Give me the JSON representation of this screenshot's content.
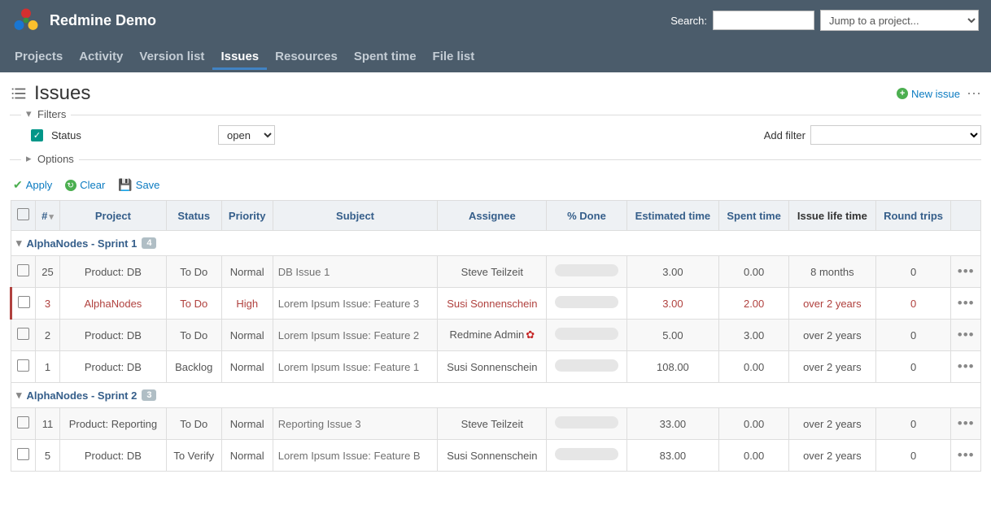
{
  "header": {
    "app_title": "Redmine Demo",
    "search_label": "Search:",
    "jump_placeholder": "Jump to a project..."
  },
  "nav": {
    "items": [
      "Projects",
      "Activity",
      "Version list",
      "Issues",
      "Resources",
      "Spent time",
      "File list"
    ],
    "active_index": 3
  },
  "page": {
    "title": "Issues",
    "new_issue_label": "New issue"
  },
  "filters": {
    "legend": "Filters",
    "status_label": "Status",
    "status_value": "open",
    "add_filter_label": "Add filter"
  },
  "options": {
    "legend": "Options"
  },
  "actions": {
    "apply": "Apply",
    "clear": "Clear",
    "save": "Save"
  },
  "table": {
    "columns": [
      "",
      "#",
      "Project",
      "Status",
      "Priority",
      "Subject",
      "Assignee",
      "% Done",
      "Estimated time",
      "Spent time",
      "Issue life time",
      "Round trips",
      ""
    ],
    "groups": [
      {
        "title": "AlphaNodes - Sprint 1",
        "count": "4",
        "rows": [
          {
            "id": "25",
            "project": "Product: DB",
            "status": "To Do",
            "priority": "Normal",
            "subject": "DB Issue 1",
            "assignee": "Steve Teilzeit",
            "est": "3.00",
            "spent": "0.00",
            "life": "8 months",
            "trips": "0",
            "red": false,
            "odd": true
          },
          {
            "id": "3",
            "project": "AlphaNodes",
            "status": "To Do",
            "priority": "High",
            "subject": "Lorem Ipsum Issue: Feature 3",
            "assignee": "Susi Sonnenschein",
            "est": "3.00",
            "spent": "2.00",
            "life": "over 2 years",
            "trips": "0",
            "red": true,
            "odd": false
          },
          {
            "id": "2",
            "project": "Product: DB",
            "status": "To Do",
            "priority": "Normal",
            "subject": "Lorem Ipsum Issue: Feature 2",
            "assignee": "Redmine Admin",
            "est": "5.00",
            "spent": "3.00",
            "life": "over 2 years",
            "trips": "0",
            "red": false,
            "odd": true,
            "admin": true
          },
          {
            "id": "1",
            "project": "Product: DB",
            "status": "Backlog",
            "priority": "Normal",
            "subject": "Lorem Ipsum Issue: Feature 1",
            "assignee": "Susi Sonnenschein",
            "est": "108.00",
            "spent": "0.00",
            "life": "over 2 years",
            "trips": "0",
            "red": false,
            "odd": false
          }
        ]
      },
      {
        "title": "AlphaNodes - Sprint 2",
        "count": "3",
        "rows": [
          {
            "id": "11",
            "project": "Product: Reporting",
            "status": "To Do",
            "priority": "Normal",
            "subject": "Reporting Issue 3",
            "assignee": "Steve Teilzeit",
            "est": "33.00",
            "spent": "0.00",
            "life": "over 2 years",
            "trips": "0",
            "red": false,
            "odd": true
          },
          {
            "id": "5",
            "project": "Product: DB",
            "status": "To Verify",
            "priority": "Normal",
            "subject": "Lorem Ipsum Issue: Feature B",
            "assignee": "Susi Sonnenschein",
            "est": "83.00",
            "spent": "0.00",
            "life": "over 2 years",
            "trips": "0",
            "red": false,
            "odd": false
          }
        ]
      }
    ]
  }
}
